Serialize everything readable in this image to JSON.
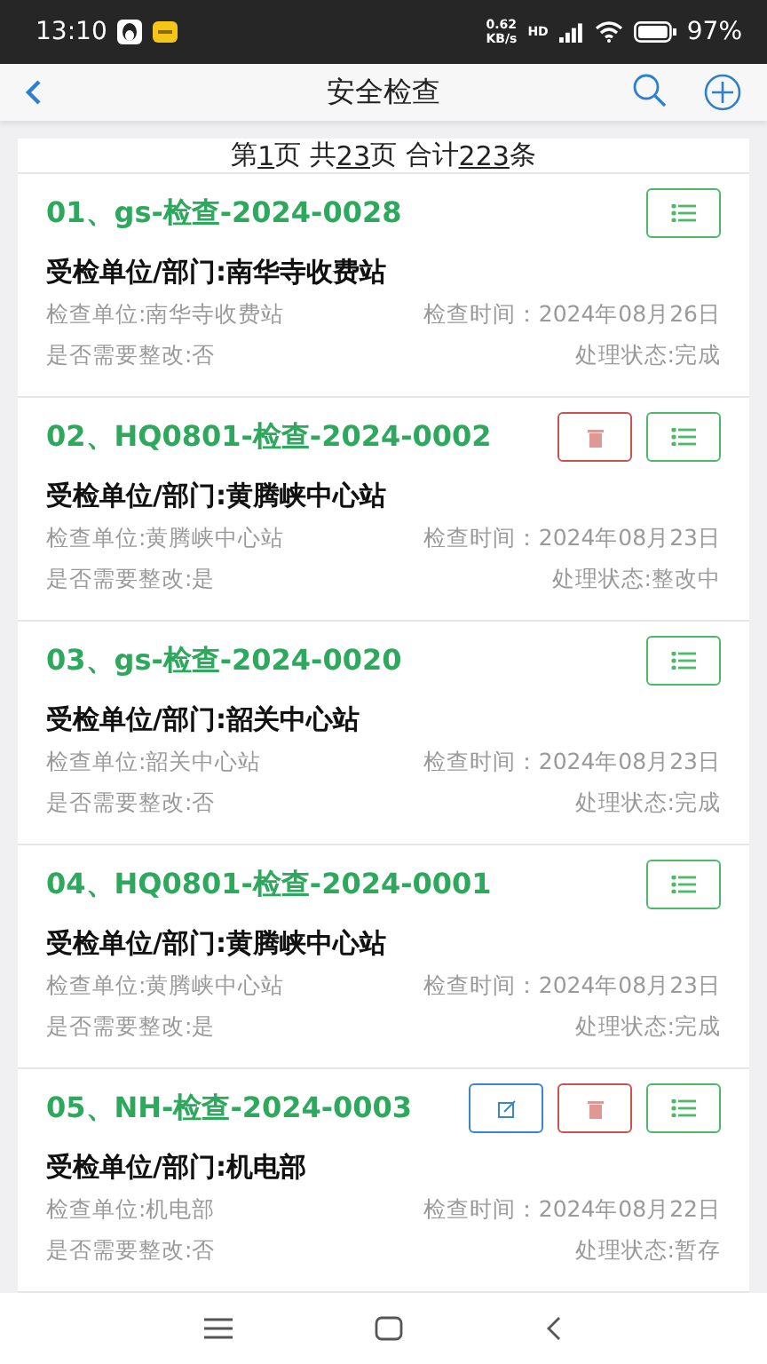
{
  "status_bar": {
    "time": "13:10",
    "speed": "0.62",
    "speed_unit": "KB/s",
    "network": "HD",
    "battery": "97%"
  },
  "header": {
    "title": "安全检查"
  },
  "pager": [
    {
      "text": "第",
      "underline": false
    },
    {
      "text": "1",
      "underline": true
    },
    {
      "text": "页 共",
      "underline": false
    },
    {
      "text": "23",
      "underline": true
    },
    {
      "text": "页 合计",
      "underline": false
    },
    {
      "text": "223",
      "underline": true
    },
    {
      "text": "条",
      "underline": false
    }
  ],
  "records": [
    {
      "title": "01、gs-检查-2024-0028",
      "actions": [
        {
          "kind": "detail"
        }
      ],
      "unit": "受检单位/部门:南华寺收费站",
      "inspector": "检查单位:南华寺收费站",
      "time": "检查时间：2024年08月26日",
      "rectify": "是否需要整改:否",
      "status": "处理状态:完成"
    },
    {
      "title": "02、HQ0801-检查-2024-0002",
      "actions": [
        {
          "kind": "delete"
        },
        {
          "kind": "detail"
        }
      ],
      "unit": "受检单位/部门:黄腾峡中心站",
      "inspector": "检查单位:黄腾峡中心站",
      "time": "检查时间：2024年08月23日",
      "rectify": "是否需要整改:是",
      "status": "处理状态:整改中"
    },
    {
      "title": "03、gs-检查-2024-0020",
      "actions": [
        {
          "kind": "detail"
        }
      ],
      "unit": "受检单位/部门:韶关中心站",
      "inspector": "检查单位:韶关中心站",
      "time": "检查时间：2024年08月23日",
      "rectify": "是否需要整改:否",
      "status": "处理状态:完成"
    },
    {
      "title": "04、HQ0801-检查-2024-0001",
      "actions": [
        {
          "kind": "detail"
        }
      ],
      "unit": "受检单位/部门:黄腾峡中心站",
      "inspector": "检查单位:黄腾峡中心站",
      "time": "检查时间：2024年08月23日",
      "rectify": "是否需要整改:是",
      "status": "处理状态:完成"
    },
    {
      "title": "05、NH-检查-2024-0003",
      "actions": [
        {
          "kind": "edit"
        },
        {
          "kind": "delete"
        },
        {
          "kind": "detail"
        }
      ],
      "unit": "受检单位/部门:机电部",
      "inspector": "检查单位:机电部",
      "time": "检查时间：2024年08月22日",
      "rectify": "是否需要整改:否",
      "status": "处理状态:暂存"
    }
  ]
}
